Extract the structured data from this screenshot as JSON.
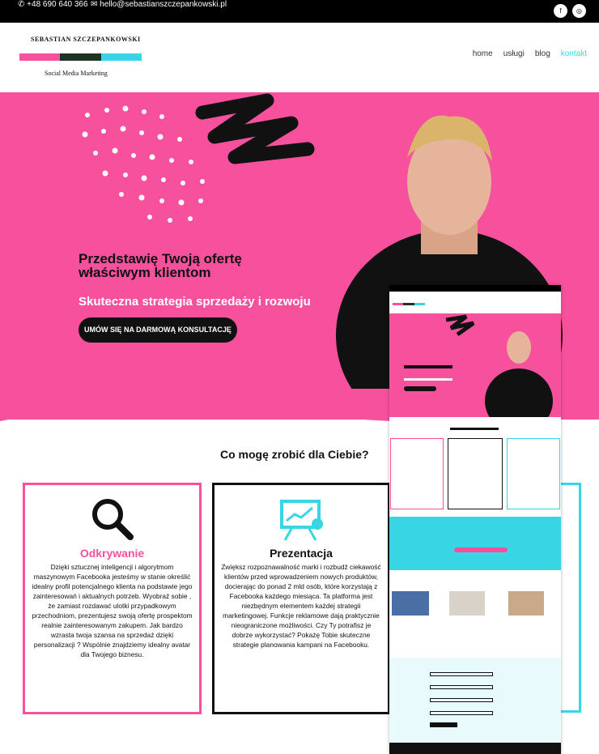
{
  "topbar": {
    "phone": "+48 690 640 366",
    "email": "hello@sebastianszczepankowski.pl",
    "social": [
      "facebook-icon",
      "instagram-icon"
    ]
  },
  "logo": {
    "name": "SEBASTIAN SZCZEPANKOWSKI",
    "subtitle": "Social Media Marketing",
    "bar_colors": [
      "#f7519d",
      "#1e3324",
      "#38d6e4"
    ]
  },
  "nav": [
    "home",
    "usługi",
    "blog",
    "kontakt"
  ],
  "hero": {
    "title_line1": "Przedstawię Twoją ofertę",
    "title_line2": "właściwym klientom",
    "subtitle": "Skuteczna strategia sprzedaży i rozwoju",
    "cta": "UMÓW SIĘ NA DARMOWĄ KONSULTACJĘ"
  },
  "services": {
    "title": "Co mogę zrobić dla Ciebie?",
    "card1": {
      "title": "Odkrywanie",
      "text": "Dzięki sztucznej inteligencji i algorytmom maszynowym Facebooka jesteśmy w stanie określić idealny profil potencjalnego klienta na podstawie jego zainteresowań i aktualnych potrzeb. Wyobraź sobie , że zamiast rozdawać ulotki przypadkowym przechodniom, prezentujesz swoją ofertę prospektom realnie zainteresowanym zakupem. Jak bardzo wzrasta twoja szansa na sprzedaż dzięki personalizacji ? Wspólnie znajdziemy idealny avatar dla Twojego biznesu."
    },
    "card2": {
      "title": "Prezentacja",
      "text": "Zwiększ rozpoznawalność marki i rozbudź ciekawość klientów przed wprowadzeniem nowych produktów, docierając do ponad 2 mld osób, które korzystają z Facebooka każdego miesiąca. Ta platforma jest niezbędnym elementem każdej strategii marketingowej. Funkcje reklamowe dają praktycznie nieograniczone możliwości. Czy Ty potrafisz je dobrze wykorzystać? Pokażę Tobie skuteczne strategie planowania kampani na Facebooku."
    }
  },
  "colors": {
    "pink": "#f7519d",
    "cyan": "#38d6e4",
    "dark": "#111111"
  }
}
